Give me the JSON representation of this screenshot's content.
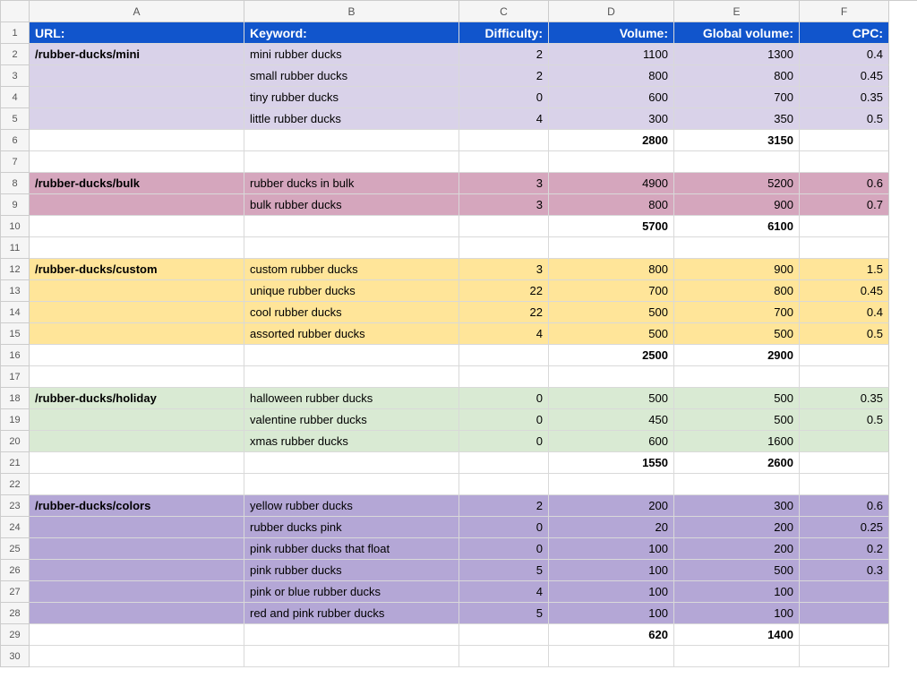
{
  "columns": [
    "A",
    "B",
    "C",
    "D",
    "E",
    "F"
  ],
  "headers": {
    "url": "URL:",
    "keyword": "Keyword:",
    "difficulty": "Difficulty:",
    "volume": "Volume:",
    "global_volume": "Global volume:",
    "cpc": "CPC:"
  },
  "rows": [
    {
      "bg": "purple-light",
      "url": "/rubber-ducks/mini",
      "keyword": "mini rubber ducks",
      "difficulty": "2",
      "volume": "1100",
      "gv": "1300",
      "cpc": "0.4",
      "url_bold": true
    },
    {
      "bg": "purple-light",
      "url": "",
      "keyword": "small rubber ducks",
      "difficulty": "2",
      "volume": "800",
      "gv": "800",
      "cpc": "0.45"
    },
    {
      "bg": "purple-light",
      "url": "",
      "keyword": "tiny rubber ducks",
      "difficulty": "0",
      "volume": "600",
      "gv": "700",
      "cpc": "0.35"
    },
    {
      "bg": "purple-light",
      "url": "",
      "keyword": "little rubber ducks",
      "difficulty": "4",
      "volume": "300",
      "gv": "350",
      "cpc": "0.5"
    },
    {
      "bg": "",
      "url": "",
      "keyword": "",
      "difficulty": "",
      "volume": "2800",
      "gv": "3150",
      "cpc": "",
      "total": true
    },
    {
      "bg": "",
      "url": "",
      "keyword": "",
      "difficulty": "",
      "volume": "",
      "gv": "",
      "cpc": ""
    },
    {
      "bg": "pink",
      "url": "/rubber-ducks/bulk",
      "keyword": "rubber ducks in bulk",
      "difficulty": "3",
      "volume": "4900",
      "gv": "5200",
      "cpc": "0.6",
      "url_bold": true
    },
    {
      "bg": "pink",
      "url": "",
      "keyword": "bulk rubber ducks",
      "difficulty": "3",
      "volume": "800",
      "gv": "900",
      "cpc": "0.7"
    },
    {
      "bg": "",
      "url": "",
      "keyword": "",
      "difficulty": "",
      "volume": "5700",
      "gv": "6100",
      "cpc": "",
      "total": true
    },
    {
      "bg": "",
      "url": "",
      "keyword": "",
      "difficulty": "",
      "volume": "",
      "gv": "",
      "cpc": ""
    },
    {
      "bg": "yellow",
      "url": "/rubber-ducks/custom",
      "keyword": "custom rubber ducks",
      "difficulty": "3",
      "volume": "800",
      "gv": "900",
      "cpc": "1.5",
      "url_bold": true
    },
    {
      "bg": "yellow",
      "url": "",
      "keyword": "unique rubber ducks",
      "difficulty": "22",
      "volume": "700",
      "gv": "800",
      "cpc": "0.45"
    },
    {
      "bg": "yellow",
      "url": "",
      "keyword": "cool rubber ducks",
      "difficulty": "22",
      "volume": "500",
      "gv": "700",
      "cpc": "0.4"
    },
    {
      "bg": "yellow",
      "url": "",
      "keyword": "assorted rubber ducks",
      "difficulty": "4",
      "volume": "500",
      "gv": "500",
      "cpc": "0.5"
    },
    {
      "bg": "",
      "url": "",
      "keyword": "",
      "difficulty": "",
      "volume": "2500",
      "gv": "2900",
      "cpc": "",
      "total": true
    },
    {
      "bg": "",
      "url": "",
      "keyword": "",
      "difficulty": "",
      "volume": "",
      "gv": "",
      "cpc": ""
    },
    {
      "bg": "green",
      "url": "/rubber-ducks/holiday",
      "keyword": "halloween rubber ducks",
      "difficulty": "0",
      "volume": "500",
      "gv": "500",
      "cpc": "0.35",
      "url_bold": true
    },
    {
      "bg": "green",
      "url": "",
      "keyword": "valentine rubber ducks",
      "difficulty": "0",
      "volume": "450",
      "gv": "500",
      "cpc": "0.5"
    },
    {
      "bg": "green",
      "url": "",
      "keyword": "xmas rubber ducks",
      "difficulty": "0",
      "volume": "600",
      "gv": "1600",
      "cpc": ""
    },
    {
      "bg": "",
      "url": "",
      "keyword": "",
      "difficulty": "",
      "volume": "1550",
      "gv": "2600",
      "cpc": "",
      "total": true
    },
    {
      "bg": "",
      "url": "",
      "keyword": "",
      "difficulty": "",
      "volume": "",
      "gv": "",
      "cpc": ""
    },
    {
      "bg": "purple",
      "url": "/rubber-ducks/colors",
      "keyword": "yellow rubber ducks",
      "difficulty": "2",
      "volume": "200",
      "gv": "300",
      "cpc": "0.6",
      "url_bold": true
    },
    {
      "bg": "purple",
      "url": "",
      "keyword": "rubber ducks pink",
      "difficulty": "0",
      "volume": "20",
      "gv": "200",
      "cpc": "0.25"
    },
    {
      "bg": "purple",
      "url": "",
      "keyword": "pink rubber ducks that float",
      "difficulty": "0",
      "volume": "100",
      "gv": "200",
      "cpc": "0.2"
    },
    {
      "bg": "purple",
      "url": "",
      "keyword": "pink rubber ducks",
      "difficulty": "5",
      "volume": "100",
      "gv": "500",
      "cpc": "0.3"
    },
    {
      "bg": "purple",
      "url": "",
      "keyword": "pink or blue rubber ducks",
      "difficulty": "4",
      "volume": "100",
      "gv": "100",
      "cpc": ""
    },
    {
      "bg": "purple",
      "url": "",
      "keyword": "red and pink rubber ducks",
      "difficulty": "5",
      "volume": "100",
      "gv": "100",
      "cpc": ""
    },
    {
      "bg": "",
      "url": "",
      "keyword": "",
      "difficulty": "",
      "volume": "620",
      "gv": "1400",
      "cpc": "",
      "total": true
    },
    {
      "bg": "",
      "url": "",
      "keyword": "",
      "difficulty": "",
      "volume": "",
      "gv": "",
      "cpc": ""
    }
  ]
}
